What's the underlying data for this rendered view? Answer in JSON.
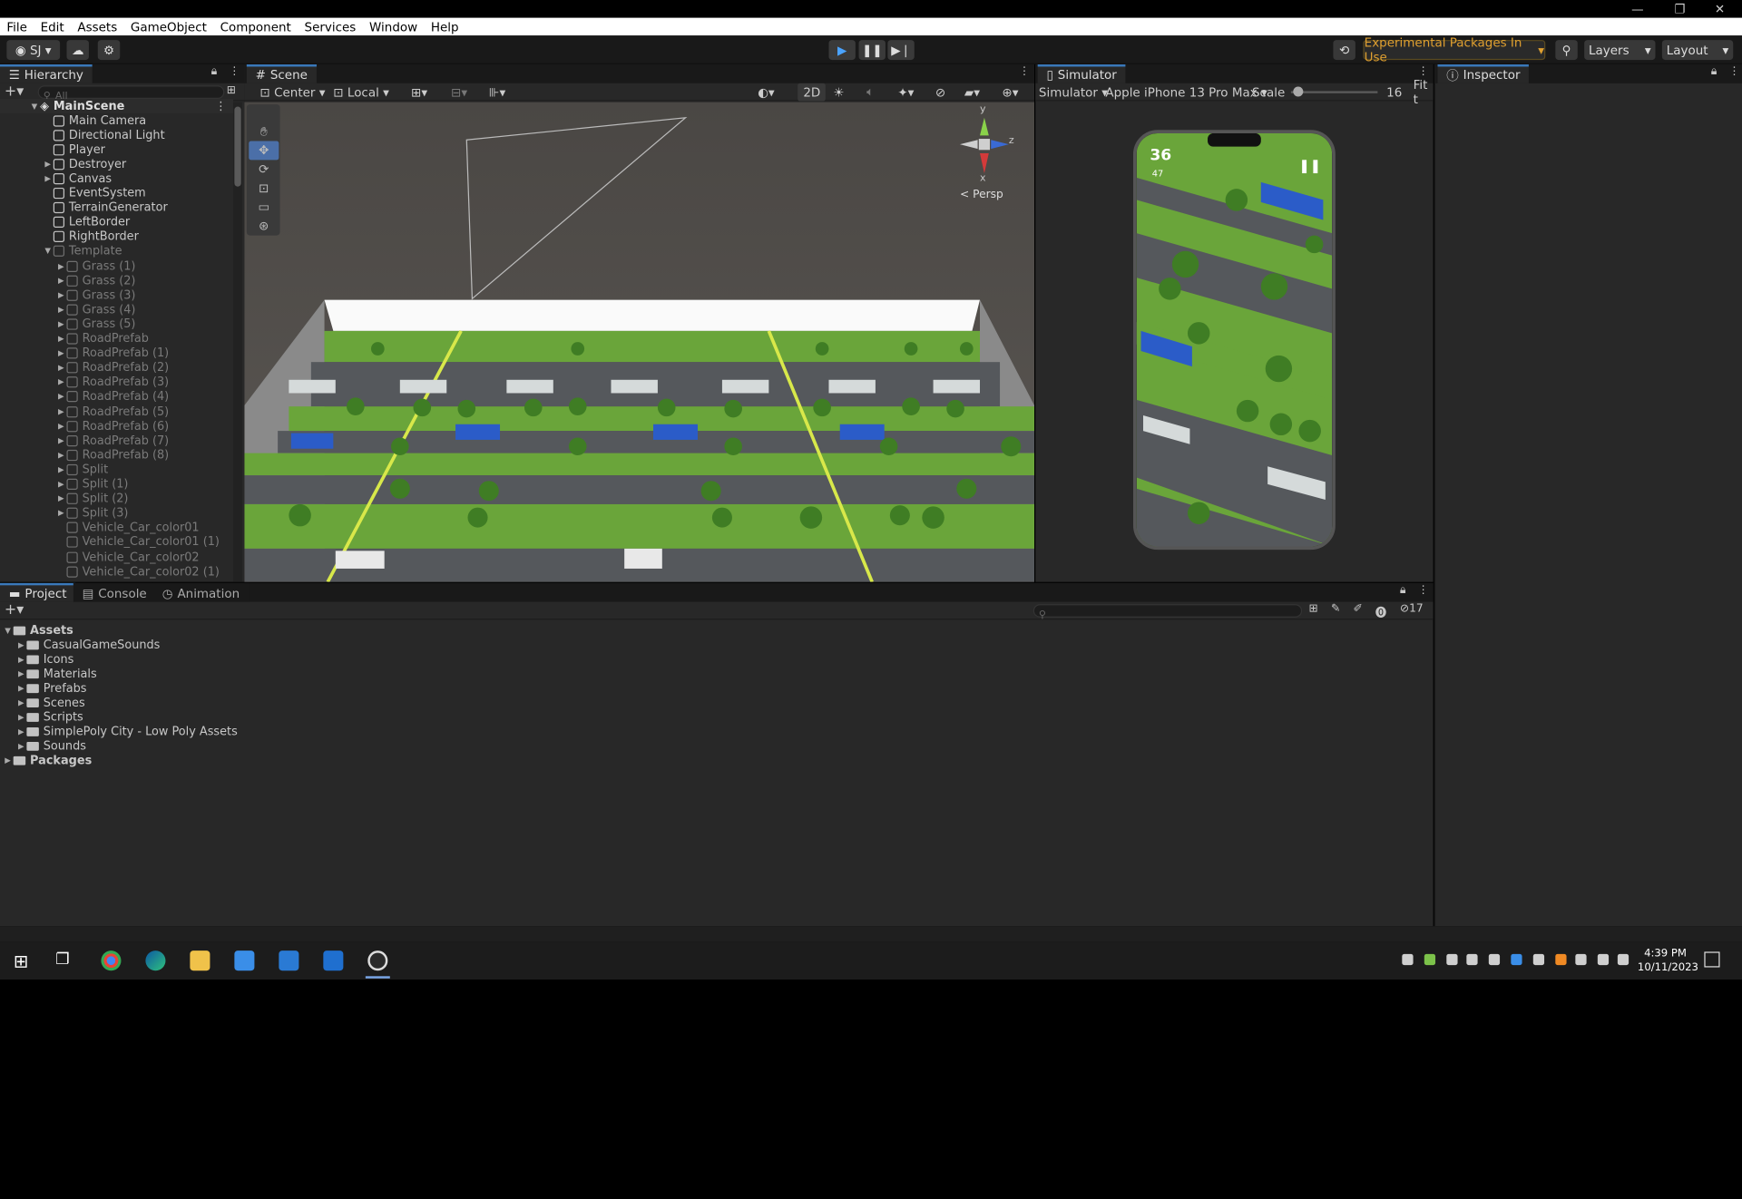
{
  "menu": [
    "File",
    "Edit",
    "Assets",
    "GameObject",
    "Component",
    "Services",
    "Window",
    "Help"
  ],
  "toolbar": {
    "account": "SJ",
    "experimental_label": "Experimental Packages In Use",
    "layers_label": "Layers",
    "layout_label": "Layout"
  },
  "hierarchy": {
    "tab_label": "Hierarchy",
    "search_placeholder": "All",
    "scene_name": "MainScene",
    "items": [
      {
        "label": "Main Camera"
      },
      {
        "label": "Directional Light"
      },
      {
        "label": "Player"
      },
      {
        "label": "Destroyer"
      },
      {
        "label": "Canvas"
      },
      {
        "label": "EventSystem"
      },
      {
        "label": "TerrainGenerator"
      },
      {
        "label": "LeftBorder"
      },
      {
        "label": "RightBorder"
      },
      {
        "label": "Template"
      },
      {
        "label": "Grass (1)"
      },
      {
        "label": "Grass (2)"
      },
      {
        "label": "Grass (3)"
      },
      {
        "label": "Grass (4)"
      },
      {
        "label": "Grass (5)"
      },
      {
        "label": "RoadPrefab"
      },
      {
        "label": "RoadPrefab (1)"
      },
      {
        "label": "RoadPrefab (2)"
      },
      {
        "label": "RoadPrefab (3)"
      },
      {
        "label": "RoadPrefab (4)"
      },
      {
        "label": "RoadPrefab (5)"
      },
      {
        "label": "RoadPrefab (6)"
      },
      {
        "label": "RoadPrefab (7)"
      },
      {
        "label": "RoadPrefab (8)"
      },
      {
        "label": "Split"
      },
      {
        "label": "Split (1)"
      },
      {
        "label": "Split (2)"
      },
      {
        "label": "Split (3)"
      },
      {
        "label": "Vehicle_Car_color01"
      },
      {
        "label": "Vehicle_Car_color01 (1)"
      },
      {
        "label": "Vehicle_Car_color02"
      },
      {
        "label": "Vehicle_Car_color02 (1)"
      }
    ]
  },
  "scene": {
    "tab_label": "Scene",
    "pivot_label": "Center",
    "space_label": "Local",
    "mode_2d": "2D",
    "persp_label": "Persp",
    "gizmo_y": "y",
    "gizmo_z": "z",
    "gizmo_x": "x"
  },
  "simulator": {
    "tab_label": "Simulator",
    "mode_label": "Simulator",
    "device_label": "Apple iPhone 13 Pro Max",
    "scale_label": "Scale",
    "scale_value": "16",
    "fit_label": "Fit t",
    "score": "36",
    "coins": "47"
  },
  "inspector": {
    "tab_label": "Inspector"
  },
  "bottom": {
    "tabs": [
      "Project",
      "Console",
      "Animation"
    ],
    "hidden_count": "17",
    "assets_label": "Assets",
    "folders": [
      "CasualGameSounds",
      "Icons",
      "Materials",
      "Prefabs",
      "Scenes",
      "Scripts",
      "SimplePoly City - Low Poly Assets",
      "Sounds"
    ],
    "packages_label": "Packages"
  },
  "taskbar": {
    "time": "4:39 PM",
    "date": "10/11/2023"
  }
}
